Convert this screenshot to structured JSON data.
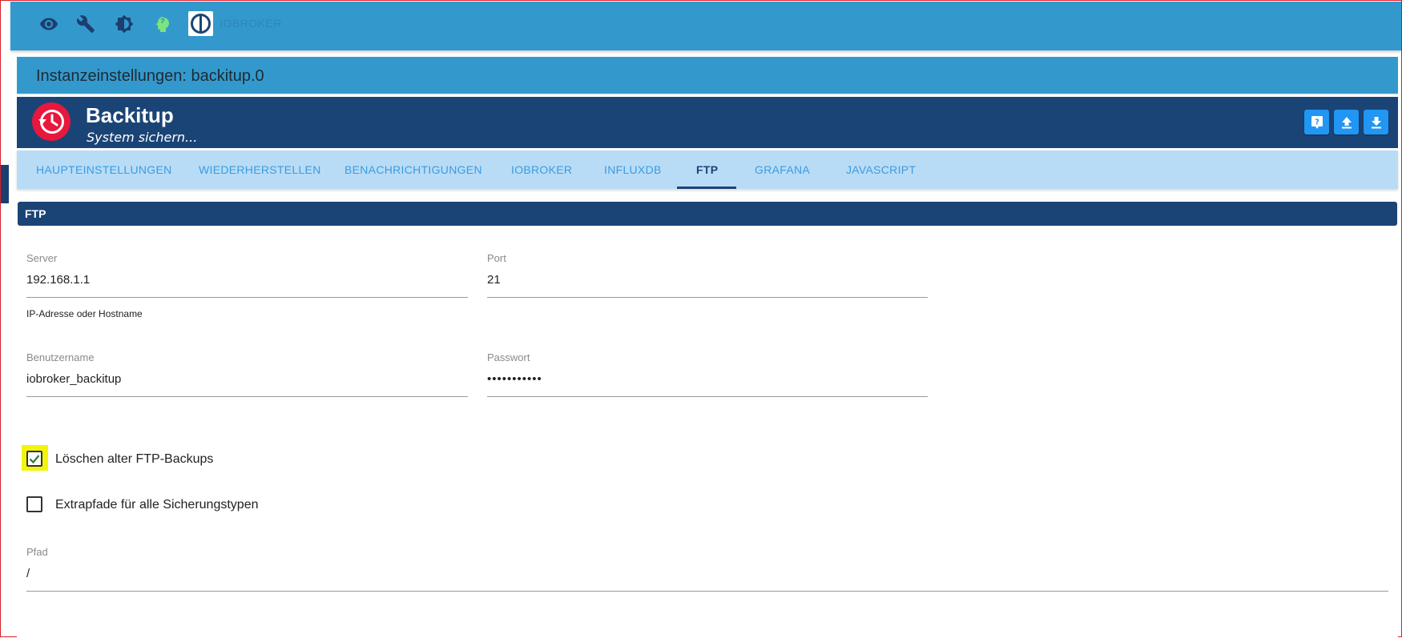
{
  "topbar": {
    "icons": [
      "eye-icon",
      "wrench-icon",
      "brightness-icon",
      "expert-mode-icon"
    ],
    "brand_text": "IOBROKER"
  },
  "dialog": {
    "title": "Instanzeinstellungen: backitup.0"
  },
  "adapter": {
    "name": "Backitup",
    "subtitle": "System sichern..."
  },
  "header_buttons": [
    "help-icon",
    "upload-icon",
    "download-icon"
  ],
  "tabs": [
    {
      "label": "HAUPTEINSTELLUNGEN",
      "active": false
    },
    {
      "label": "WIEDERHERSTELLEN",
      "active": false
    },
    {
      "label": "BENACHRICHTIGUNGEN",
      "active": false
    },
    {
      "label": "IOBROKER",
      "active": false
    },
    {
      "label": "INFLUXDB",
      "active": false
    },
    {
      "label": "FTP",
      "active": true
    },
    {
      "label": "GRAFANA",
      "active": false
    },
    {
      "label": "JAVASCRIPT",
      "active": false
    }
  ],
  "section": {
    "title": "FTP"
  },
  "fields": {
    "server": {
      "label": "Server",
      "value": "192.168.1.1",
      "help": "IP-Adresse oder Hostname"
    },
    "port": {
      "label": "Port",
      "value": "21"
    },
    "username": {
      "label": "Benutzername",
      "value": "iobroker_backitup"
    },
    "password": {
      "label": "Passwort",
      "value": "•••••••••••"
    },
    "path": {
      "label": "Pfad",
      "value": "/"
    }
  },
  "checkboxes": {
    "delete_old": {
      "label": "Löschen alter FTP-Backups",
      "checked": true
    },
    "extra_paths": {
      "label": "Extrapfade für alle Sicherungstypen",
      "checked": false
    }
  },
  "colors": {
    "topbar": "#3399cc",
    "header": "#1b4476",
    "tabs_bg": "#b9dcf6",
    "tab_text": "#3a9be0",
    "button": "#2196f3",
    "highlight": "#f2f50a",
    "check": "#2e7d32"
  }
}
